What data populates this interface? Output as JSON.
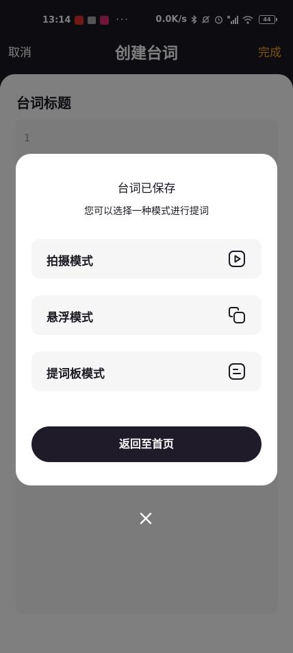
{
  "status_bar": {
    "time": "13:14",
    "network_speed": "0.0K/s",
    "more_dots": "···",
    "battery": "44"
  },
  "nav": {
    "cancel_label": "取消",
    "title": "创建台词",
    "done_label": "完成",
    "done_color": "#f6a623"
  },
  "form": {
    "title_label": "台词标题",
    "title_value": "1"
  },
  "dialog": {
    "title": "台词已保存",
    "subtitle": "您可以选择一种模式进行提词",
    "modes": [
      {
        "label": "拍摄模式",
        "icon": "play-square-icon"
      },
      {
        "label": "悬浮模式",
        "icon": "overlap-squares-icon"
      },
      {
        "label": "提词板模式",
        "icon": "text-board-icon"
      }
    ],
    "home_button_label": "返回至首页"
  },
  "close_icon": "close-icon"
}
